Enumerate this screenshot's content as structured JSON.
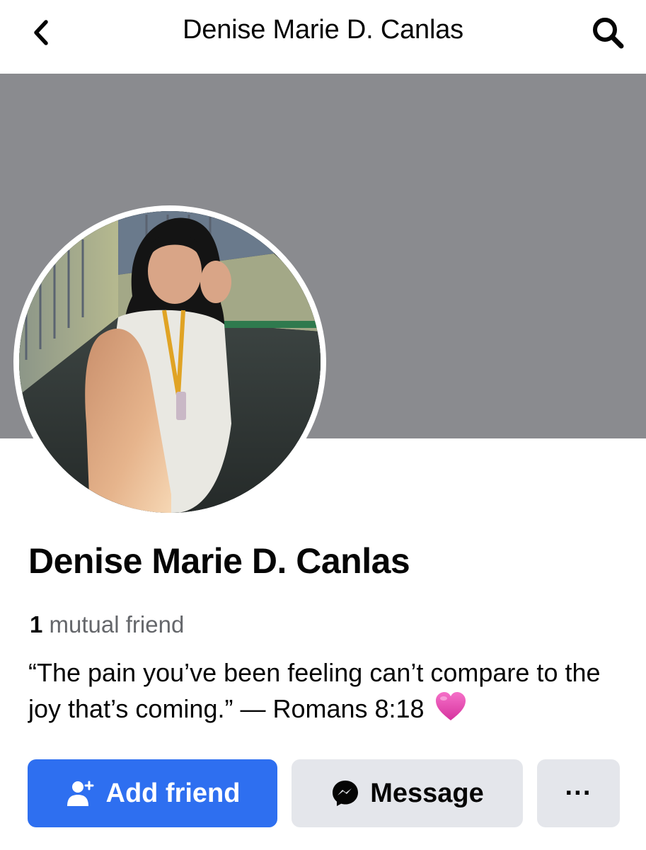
{
  "header": {
    "title": "Denise Marie D. Canlas",
    "back_icon": "chevron-left-icon",
    "search_icon": "search-icon"
  },
  "profile": {
    "name": "Denise Marie D. Canlas",
    "mutual_count": "1",
    "mutual_label": "mutual friend",
    "bio": "“The pain you’ve been feeling can’t compare to the joy that’s coming.” — Romans 8:18",
    "bio_emoji": "pink-heart-icon"
  },
  "actions": {
    "add_friend_label": "Add friend",
    "message_label": "Message",
    "more_label": "···"
  },
  "colors": {
    "cover": "#8a8b8f",
    "primary": "#2e6ff0",
    "secondary_button": "#e4e6eb",
    "muted_text": "#65676b"
  }
}
